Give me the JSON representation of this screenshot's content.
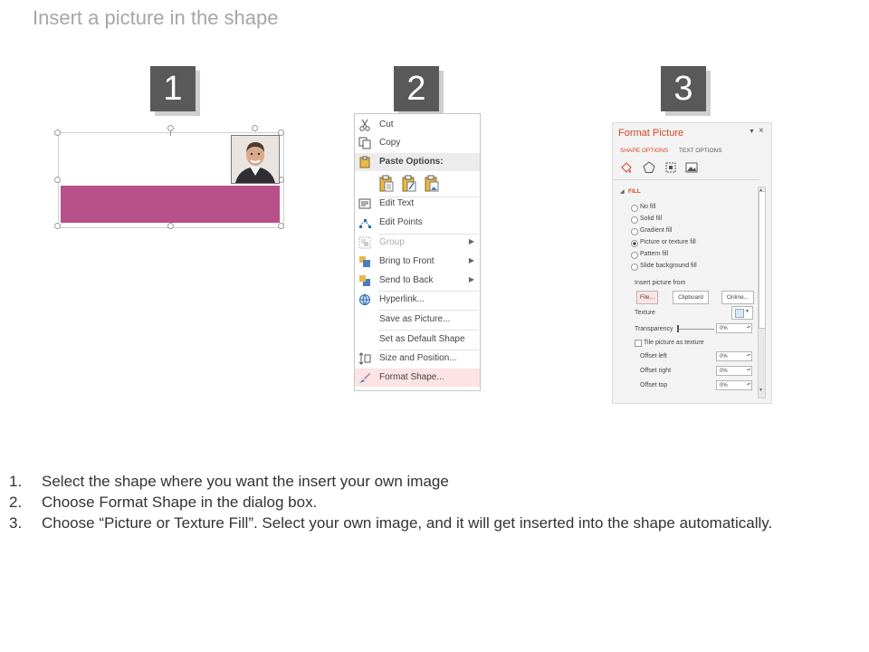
{
  "page": {
    "title": "Insert a picture in the shape"
  },
  "steps": {
    "badges": [
      "1",
      "2",
      "3"
    ]
  },
  "panel1": {
    "shape_fill_color": "#b8508a"
  },
  "context_menu": {
    "cut": "Cut",
    "copy": "Copy",
    "paste_options": "Paste Options:",
    "edit_text": "Edit Text",
    "edit_points": "Edit Points",
    "group": "Group",
    "bring_to_front": "Bring to Front",
    "send_to_back": "Send to Back",
    "hyperlink": "Hyperlink...",
    "save_as_picture": "Save as Picture...",
    "set_default_shape": "Set as Default Shape",
    "size_and_position": "Size and Position...",
    "format_shape": "Format Shape...",
    "highlight_color": "#fde3e3"
  },
  "format_pane": {
    "title": "Format Picture",
    "tab_shape_options": "SHAPE OPTIONS",
    "tab_text_options": "TEXT OPTIONS",
    "fill_header": "FILL",
    "fill_options": [
      "No fill",
      "Solid fill",
      "Gradient fill",
      "Picture or texture fill",
      "Pattern fill",
      "Slide background fill"
    ],
    "selected_fill": "Picture or texture fill",
    "insert_picture_from": "Insert picture from",
    "btn_file": "File...",
    "btn_clipboard": "Clipboard",
    "btn_online": "Online...",
    "texture_label": "Texture",
    "transparency_label": "Transparency",
    "transparency_value": "0%",
    "tile_label": "Tile picture as texture",
    "offset_left_label": "Offset left",
    "offset_left_value": "0%",
    "offset_right_label": "Offset right",
    "offset_right_value": "0%",
    "offset_top_label": "Offset top",
    "offset_top_value": "0%",
    "accent_color": "#d24726"
  },
  "instructions": [
    {
      "num": "1.",
      "text": "Select the shape where you want the insert your own image"
    },
    {
      "num": "2.",
      "text": "Choose Format Shape in the dialog box."
    },
    {
      "num": "3.",
      "text": "Choose “Picture or Texture Fill”. Select your own image, and it will get inserted into the shape automatically."
    }
  ]
}
